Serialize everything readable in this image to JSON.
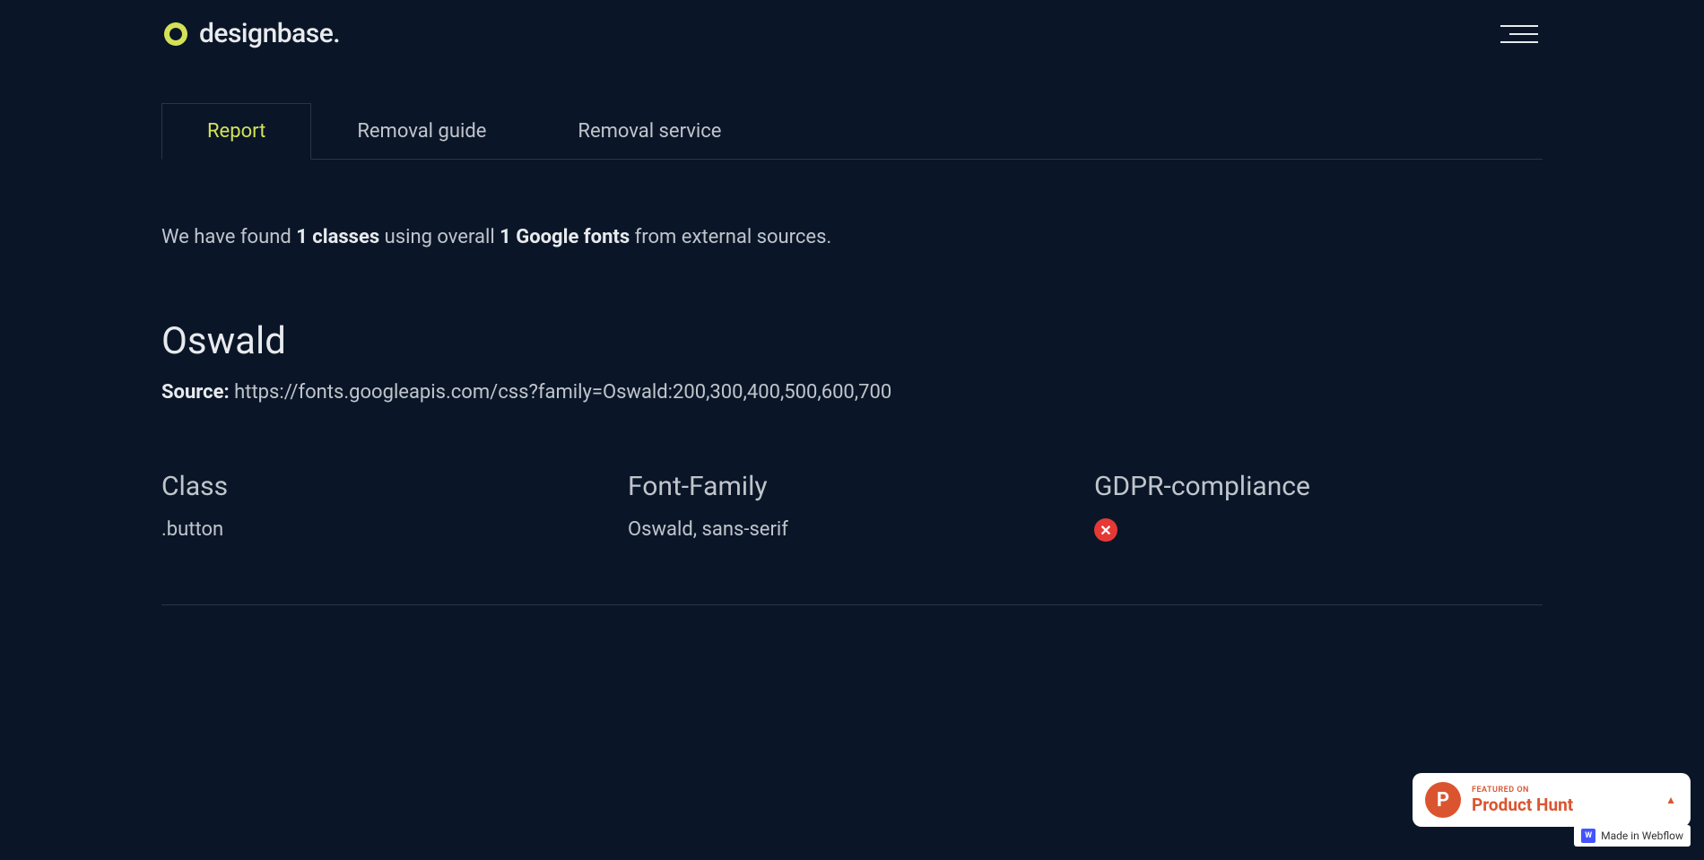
{
  "header": {
    "logo_text": "designbase."
  },
  "tabs": [
    {
      "label": "Report",
      "active": true
    },
    {
      "label": "Removal guide",
      "active": false
    },
    {
      "label": "Removal service",
      "active": false
    }
  ],
  "summary": {
    "prefix": "We have found ",
    "classes_count": "1 classes",
    "middle": " using overall ",
    "fonts_count": "1 Google fonts",
    "suffix": " from external sources."
  },
  "font": {
    "name": "Oswald",
    "source_label": "Source:",
    "source_url": "https://fonts.googleapis.com/css?family=Oswald:200,300,400,500,600,700"
  },
  "table": {
    "headers": {
      "class": "Class",
      "font_family": "Font-Family",
      "gdpr": "GDPR-compliance"
    },
    "rows": [
      {
        "class": ".button",
        "font_family": "Oswald, sans-serif",
        "gdpr_compliant": false
      }
    ]
  },
  "badges": {
    "product_hunt": {
      "featured": "FEATURED ON",
      "name": "Product Hunt"
    },
    "webflow": {
      "text": "Made in Webflow",
      "icon_letter": "W"
    }
  }
}
